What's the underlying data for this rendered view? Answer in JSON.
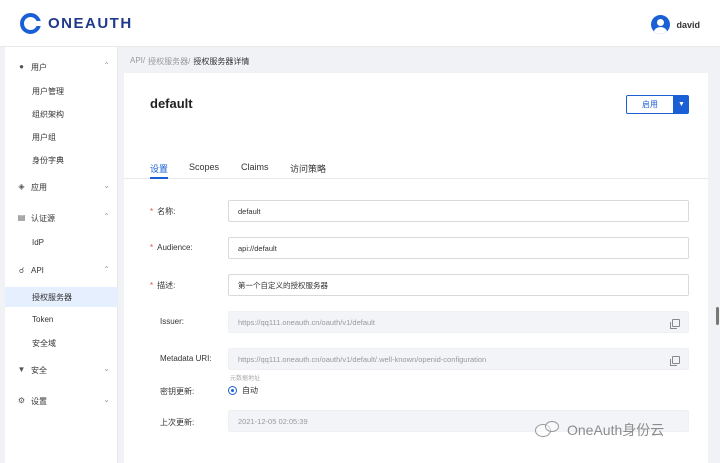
{
  "header": {
    "logo_text": "ONEAUTH",
    "username": "david"
  },
  "sidebar": {
    "groups": [
      {
        "label": "用户",
        "icon": "user-icon"
      },
      {
        "label": "应用",
        "icon": "stack-icon"
      },
      {
        "label": "认证源",
        "icon": "id-card-icon"
      },
      {
        "label": "API",
        "icon": "share-icon"
      },
      {
        "label": "安全",
        "icon": "shield-icon"
      },
      {
        "label": "设置",
        "icon": "gear-icon"
      }
    ],
    "items": [
      {
        "label": "用户管理"
      },
      {
        "label": "组织架构"
      },
      {
        "label": "用户组"
      },
      {
        "label": "身份字典"
      },
      {
        "label": "IdP"
      },
      {
        "label": "授权服务器"
      },
      {
        "label": "Token"
      },
      {
        "label": "安全域"
      }
    ]
  },
  "breadcrumb": {
    "a": "API/",
    "b": "授权服务器/",
    "c": "授权服务器详情"
  },
  "detail": {
    "title": "default",
    "enable_label": "启用",
    "tabs": [
      {
        "label": "设置"
      },
      {
        "label": "Scopes"
      },
      {
        "label": "Claims"
      },
      {
        "label": "访问策略"
      }
    ],
    "fields": {
      "name": {
        "label": "名称:",
        "value": "default"
      },
      "audience": {
        "label": "Audience:",
        "value": "api://default"
      },
      "description": {
        "label": "描述:",
        "value": "第一个自定义的授权服务器"
      },
      "issuer": {
        "label": "Issuer:",
        "value": "https://qq111.oneauth.cn/oauth/v1/default"
      },
      "metadata_uri": {
        "label": "Metadata URI:",
        "value": "https://qq111.oneauth.cn/oauth/v1/default/.well-known/openid-configuration",
        "hint": "元数据地址"
      },
      "key_rotation": {
        "label": "密钥更新:",
        "value": "自动"
      },
      "last_update": {
        "label": "上次更新:",
        "value": "2021-12-05 02:05:39"
      }
    },
    "required_mark": "*"
  },
  "watermark": {
    "text": "OneAuth身份云"
  }
}
